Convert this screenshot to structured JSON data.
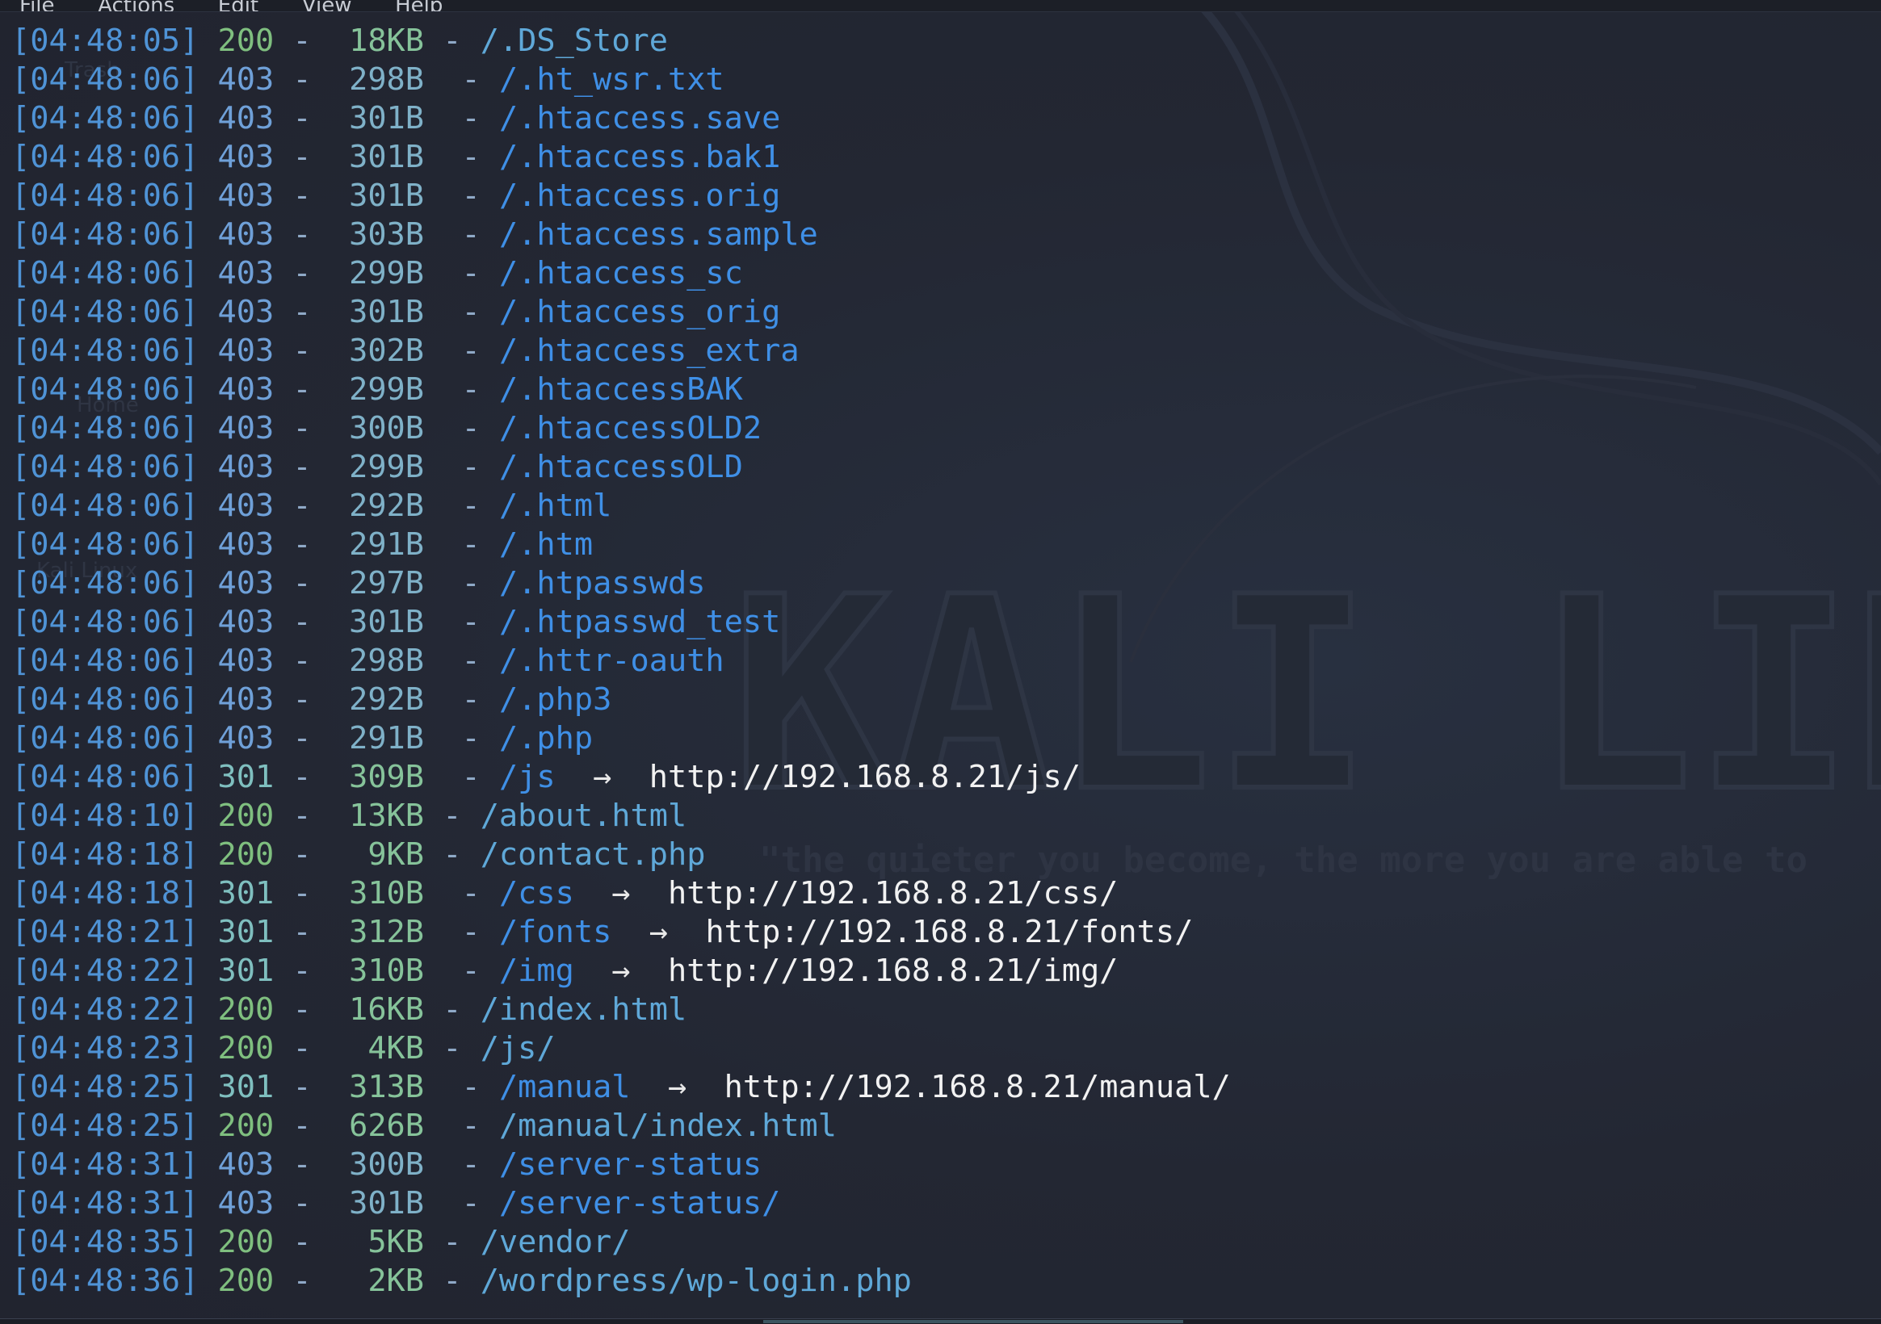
{
  "window": {
    "menu": [
      "File",
      "Actions",
      "Edit",
      "View",
      "Help"
    ]
  },
  "wallpaper": {
    "brand_text": "KALI LINU",
    "slogan_text": "\"the quieter you become, the more you are able to",
    "desktop_labels": [
      "Trash",
      "Home",
      "Kali Linux"
    ]
  },
  "colors": {
    "background": "#232733",
    "timestamp": "#4f93d6",
    "path": "#3f8fe6",
    "redirect_target": "#f2f2f2"
  },
  "log": [
    {
      "time": "[04:48:05]",
      "code": "200",
      "size": "18KB",
      "path": "/.DS_Store",
      "target": ""
    },
    {
      "time": "[04:48:06]",
      "code": "403",
      "size": "298B",
      "path": "/.ht_wsr.txt",
      "target": ""
    },
    {
      "time": "[04:48:06]",
      "code": "403",
      "size": "301B",
      "path": "/.htaccess.save",
      "target": ""
    },
    {
      "time": "[04:48:06]",
      "code": "403",
      "size": "301B",
      "path": "/.htaccess.bak1",
      "target": ""
    },
    {
      "time": "[04:48:06]",
      "code": "403",
      "size": "301B",
      "path": "/.htaccess.orig",
      "target": ""
    },
    {
      "time": "[04:48:06]",
      "code": "403",
      "size": "303B",
      "path": "/.htaccess.sample",
      "target": ""
    },
    {
      "time": "[04:48:06]",
      "code": "403",
      "size": "299B",
      "path": "/.htaccess_sc",
      "target": ""
    },
    {
      "time": "[04:48:06]",
      "code": "403",
      "size": "301B",
      "path": "/.htaccess_orig",
      "target": ""
    },
    {
      "time": "[04:48:06]",
      "code": "403",
      "size": "302B",
      "path": "/.htaccess_extra",
      "target": ""
    },
    {
      "time": "[04:48:06]",
      "code": "403",
      "size": "299B",
      "path": "/.htaccessBAK",
      "target": ""
    },
    {
      "time": "[04:48:06]",
      "code": "403",
      "size": "300B",
      "path": "/.htaccessOLD2",
      "target": ""
    },
    {
      "time": "[04:48:06]",
      "code": "403",
      "size": "299B",
      "path": "/.htaccessOLD",
      "target": ""
    },
    {
      "time": "[04:48:06]",
      "code": "403",
      "size": "292B",
      "path": "/.html",
      "target": ""
    },
    {
      "time": "[04:48:06]",
      "code": "403",
      "size": "291B",
      "path": "/.htm",
      "target": ""
    },
    {
      "time": "[04:48:06]",
      "code": "403",
      "size": "297B",
      "path": "/.htpasswds",
      "target": ""
    },
    {
      "time": "[04:48:06]",
      "code": "403",
      "size": "301B",
      "path": "/.htpasswd_test",
      "target": ""
    },
    {
      "time": "[04:48:06]",
      "code": "403",
      "size": "298B",
      "path": "/.httr-oauth",
      "target": ""
    },
    {
      "time": "[04:48:06]",
      "code": "403",
      "size": "292B",
      "path": "/.php3",
      "target": ""
    },
    {
      "time": "[04:48:06]",
      "code": "403",
      "size": "291B",
      "path": "/.php",
      "target": ""
    },
    {
      "time": "[04:48:06]",
      "code": "301",
      "size": "309B",
      "path": "/js",
      "target": "http://192.168.8.21/js/"
    },
    {
      "time": "[04:48:10]",
      "code": "200",
      "size": "13KB",
      "path": "/about.html",
      "target": ""
    },
    {
      "time": "[04:48:18]",
      "code": "200",
      "size": "9KB",
      "path": "/contact.php",
      "target": ""
    },
    {
      "time": "[04:48:18]",
      "code": "301",
      "size": "310B",
      "path": "/css",
      "target": "http://192.168.8.21/css/"
    },
    {
      "time": "[04:48:21]",
      "code": "301",
      "size": "312B",
      "path": "/fonts",
      "target": "http://192.168.8.21/fonts/"
    },
    {
      "time": "[04:48:22]",
      "code": "301",
      "size": "310B",
      "path": "/img",
      "target": "http://192.168.8.21/img/"
    },
    {
      "time": "[04:48:22]",
      "code": "200",
      "size": "16KB",
      "path": "/index.html",
      "target": ""
    },
    {
      "time": "[04:48:23]",
      "code": "200",
      "size": "4KB",
      "path": "/js/",
      "target": ""
    },
    {
      "time": "[04:48:25]",
      "code": "301",
      "size": "313B",
      "path": "/manual",
      "target": "http://192.168.8.21/manual/"
    },
    {
      "time": "[04:48:25]",
      "code": "200",
      "size": "626B",
      "path": "/manual/index.html",
      "target": ""
    },
    {
      "time": "[04:48:31]",
      "code": "403",
      "size": "300B",
      "path": "/server-status",
      "target": ""
    },
    {
      "time": "[04:48:31]",
      "code": "403",
      "size": "301B",
      "path": "/server-status/",
      "target": ""
    },
    {
      "time": "[04:48:35]",
      "code": "200",
      "size": "5KB",
      "path": "/vendor/",
      "target": ""
    },
    {
      "time": "[04:48:36]",
      "code": "200",
      "size": "2KB",
      "path": "/wordpress/wp-login.php",
      "target": ""
    }
  ]
}
